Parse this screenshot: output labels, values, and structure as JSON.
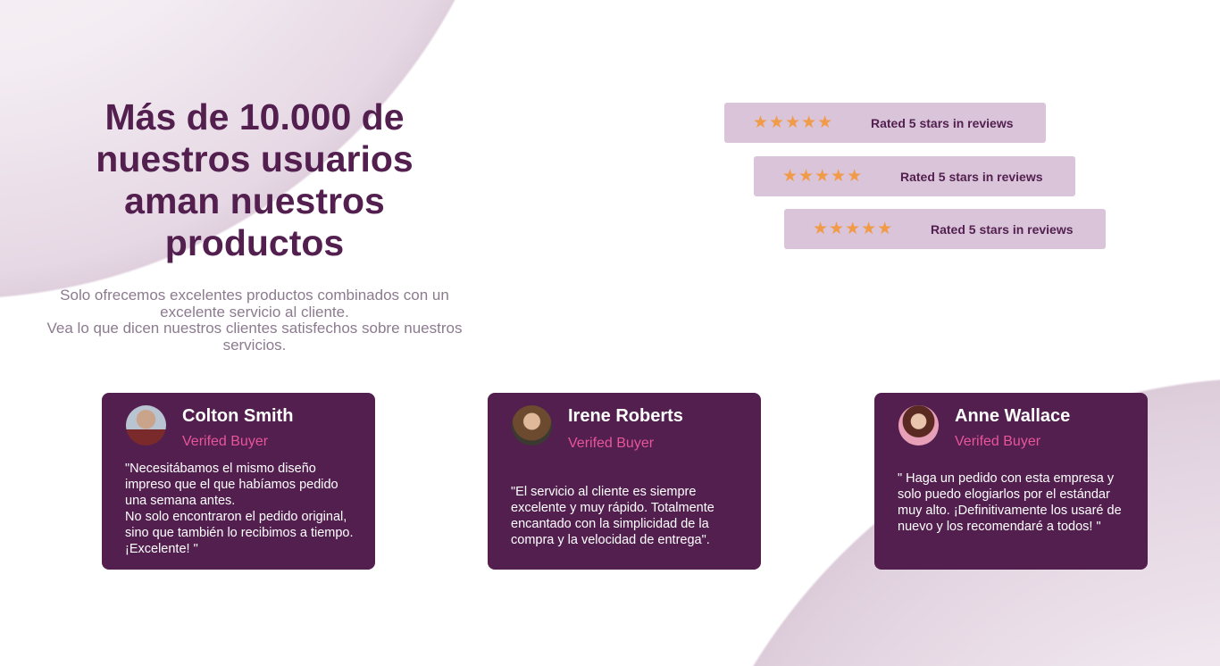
{
  "heading": "Más de 10.000 de nuestros usuarios aman nuestros productos",
  "subtitle": [
    "Solo ofrecemos excelentes productos combinados con un excelente servicio al cliente.",
    "Vea lo que dicen nuestros clientes satisfechos sobre nuestros servicios."
  ],
  "ratings": [
    {
      "stars": 5,
      "stars_glyph": "★★★★★",
      "text": "Rated 5 stars in reviews"
    },
    {
      "stars": 5,
      "stars_glyph": "★★★★★",
      "text": "Rated 5 stars in reviews"
    },
    {
      "stars": 5,
      "stars_glyph": "★★★★★",
      "text": "Rated 5 stars in reviews"
    }
  ],
  "testimonials": [
    {
      "name": "Colton Smith",
      "badge": "Verifed Buyer",
      "quote": "\"Necesitábamos el mismo diseño impreso que el que habíamos pedido una semana antes.\nNo solo encontraron el pedido original, sino que también lo recibimos a tiempo. ¡Excelente! \""
    },
    {
      "name": "Irene Roberts",
      "badge": "Verifed Buyer",
      "quote": "\"El servicio al cliente es siempre excelente y muy rápido. Totalmente encantado con la simplicidad de la compra y la velocidad de entrega\"."
    },
    {
      "name": "Anne Wallace",
      "badge": "Verifed Buyer",
      "quote": "\" Haga un pedido con esta empresa y solo puedo elogiarlos por el estándar muy alto. ¡Definitivamente los usaré de nuevo y los recomendaré a todos! \""
    }
  ],
  "colors": {
    "primary": "#521f4f",
    "rating_bg": "#d9c4d9",
    "star": "#f19a47",
    "badge": "#e8559a"
  }
}
